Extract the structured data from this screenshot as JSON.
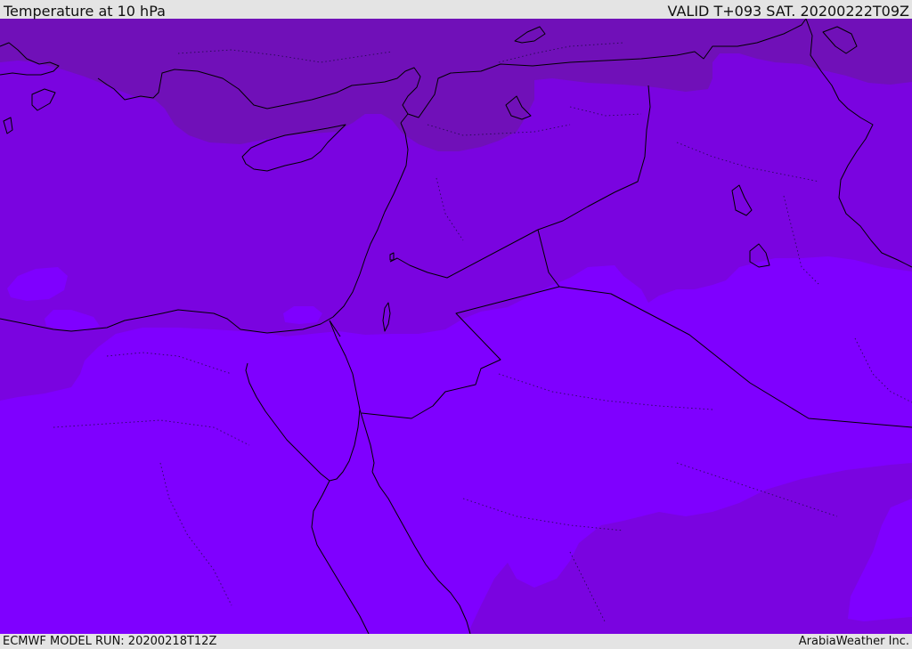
{
  "header": {
    "title": "Temperature at 10 hPa",
    "valid_time": "VALID T+093 SAT. 20200222T09Z"
  },
  "footer": {
    "model_run": "ECMWF MODEL RUN: 20200218T12Z",
    "credit": "ArabiaWeather Inc."
  },
  "colors": {
    "band_dark": "#7010b8",
    "band_mid": "#7a04e0",
    "band_light": "#7f00ff",
    "coastline": "#000000",
    "frame_background": "#e4e4e4"
  }
}
